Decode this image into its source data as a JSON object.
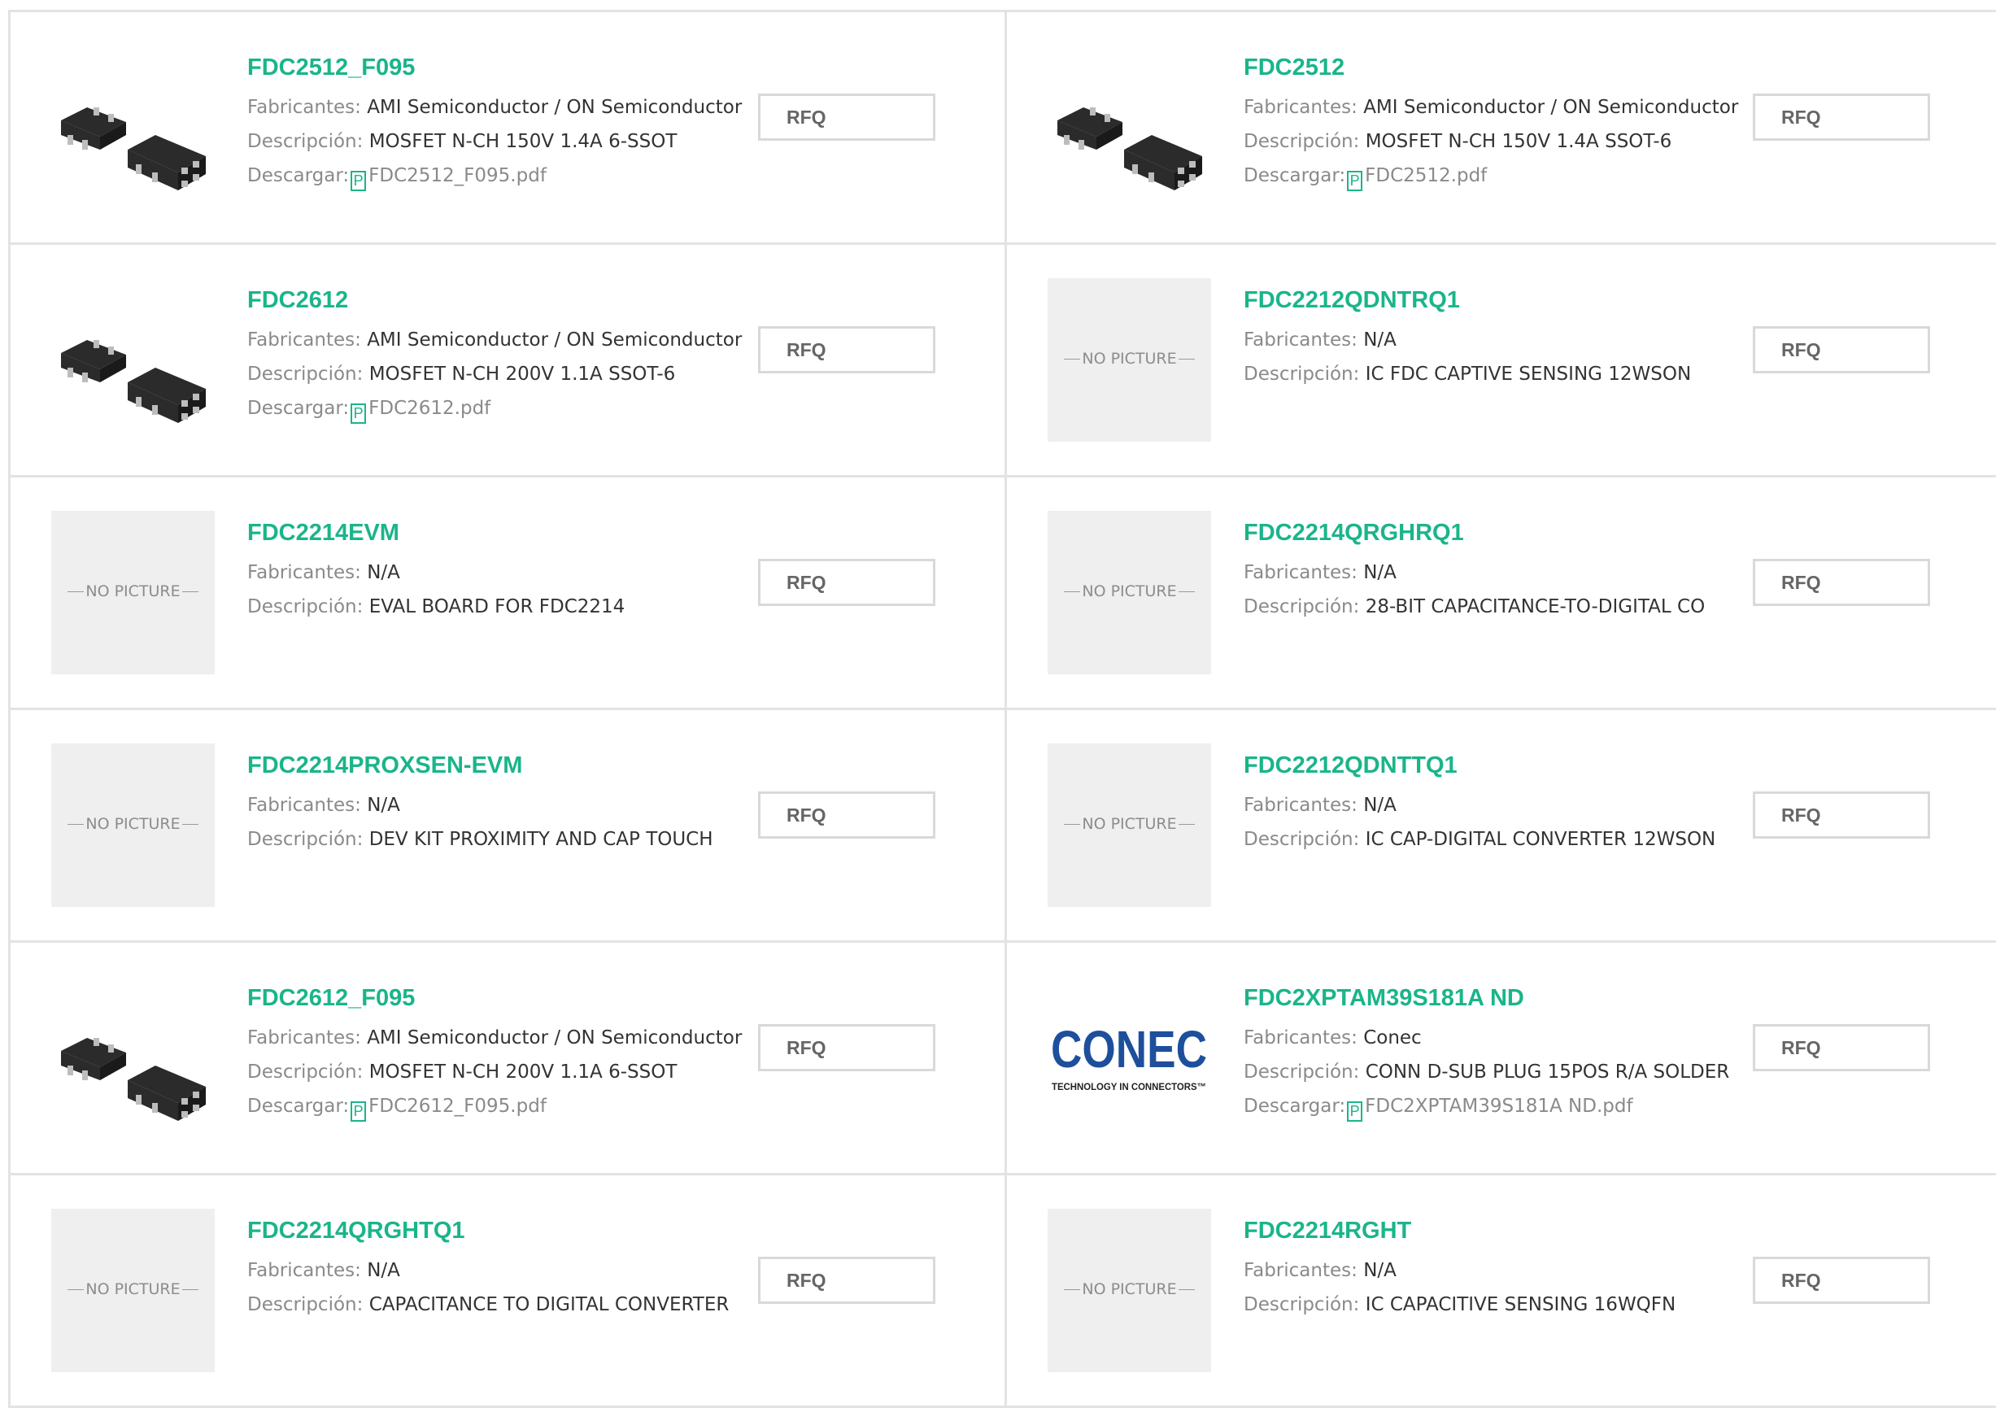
{
  "labels": {
    "manufacturer": "Fabricantes:",
    "description": "Descripción:",
    "download": "Descargar:",
    "rfq": "RFQ",
    "no_picture": "NO PICTURE",
    "pdf_glyph": "P"
  },
  "products": [
    {
      "name": "FDC2512_F095",
      "manufacturer": "AMI Semiconductor / ON Semiconductor",
      "description": "MOSFET N-CH 150V 1.4A 6-SSOT",
      "download": "FDC2512_F095.pdf",
      "image": "sot-chip"
    },
    {
      "name": "FDC2512",
      "manufacturer": "AMI Semiconductor / ON Semiconductor",
      "description": "MOSFET N-CH 150V 1.4A SSOT-6",
      "download": "FDC2512.pdf",
      "image": "sot-chip"
    },
    {
      "name": "FDC2612",
      "manufacturer": "AMI Semiconductor / ON Semiconductor",
      "description": "MOSFET N-CH 200V 1.1A SSOT-6",
      "download": "FDC2612.pdf",
      "image": "sot-chip"
    },
    {
      "name": "FDC2212QDNTRQ1",
      "manufacturer": "N/A",
      "description": "IC FDC CAPTIVE SENSING 12WSON",
      "download": "",
      "image": "no-picture"
    },
    {
      "name": "FDC2214EVM",
      "manufacturer": "N/A",
      "description": "EVAL BOARD FOR FDC2214",
      "download": "",
      "image": "no-picture"
    },
    {
      "name": "FDC2214QRGHRQ1",
      "manufacturer": "N/A",
      "description": "28-BIT CAPACITANCE-TO-DIGITAL CO",
      "download": "",
      "image": "no-picture"
    },
    {
      "name": "FDC2214PROXSEN-EVM",
      "manufacturer": "N/A",
      "description": "DEV KIT PROXIMITY AND CAP TOUCH",
      "download": "",
      "image": "no-picture"
    },
    {
      "name": "FDC2212QDNTTQ1",
      "manufacturer": "N/A",
      "description": "IC CAP-DIGITAL CONVERTER 12WSON",
      "download": "",
      "image": "no-picture"
    },
    {
      "name": "FDC2612_F095",
      "manufacturer": "AMI Semiconductor / ON Semiconductor",
      "description": "MOSFET N-CH 200V 1.1A 6-SSOT",
      "download": "FDC2612_F095.pdf",
      "image": "sot-chip"
    },
    {
      "name": "FDC2XPTAM39S181A ND",
      "manufacturer": "Conec",
      "description": "CONN D-SUB PLUG 15POS R/A SOLDER",
      "download": "FDC2XPTAM39S181A ND.pdf",
      "image": "conec-logo"
    },
    {
      "name": "FDC2214QRGHTQ1",
      "manufacturer": "N/A",
      "description": "CAPACITANCE TO DIGITAL CONVERTER",
      "download": "",
      "image": "no-picture"
    },
    {
      "name": "FDC2214RGHT",
      "manufacturer": "N/A",
      "description": "IC CAPACITIVE SENSING 16WQFN",
      "download": "",
      "image": "no-picture"
    }
  ],
  "conec_logo": {
    "word": "CONEC",
    "tagline": "TECHNOLOGY IN CONNECTORS™"
  },
  "colors": {
    "accent": "#1ab58a",
    "border": "#e3e3e3",
    "label": "#8a8a8a",
    "value": "#333333",
    "logo_blue": "#1d4f9c"
  }
}
